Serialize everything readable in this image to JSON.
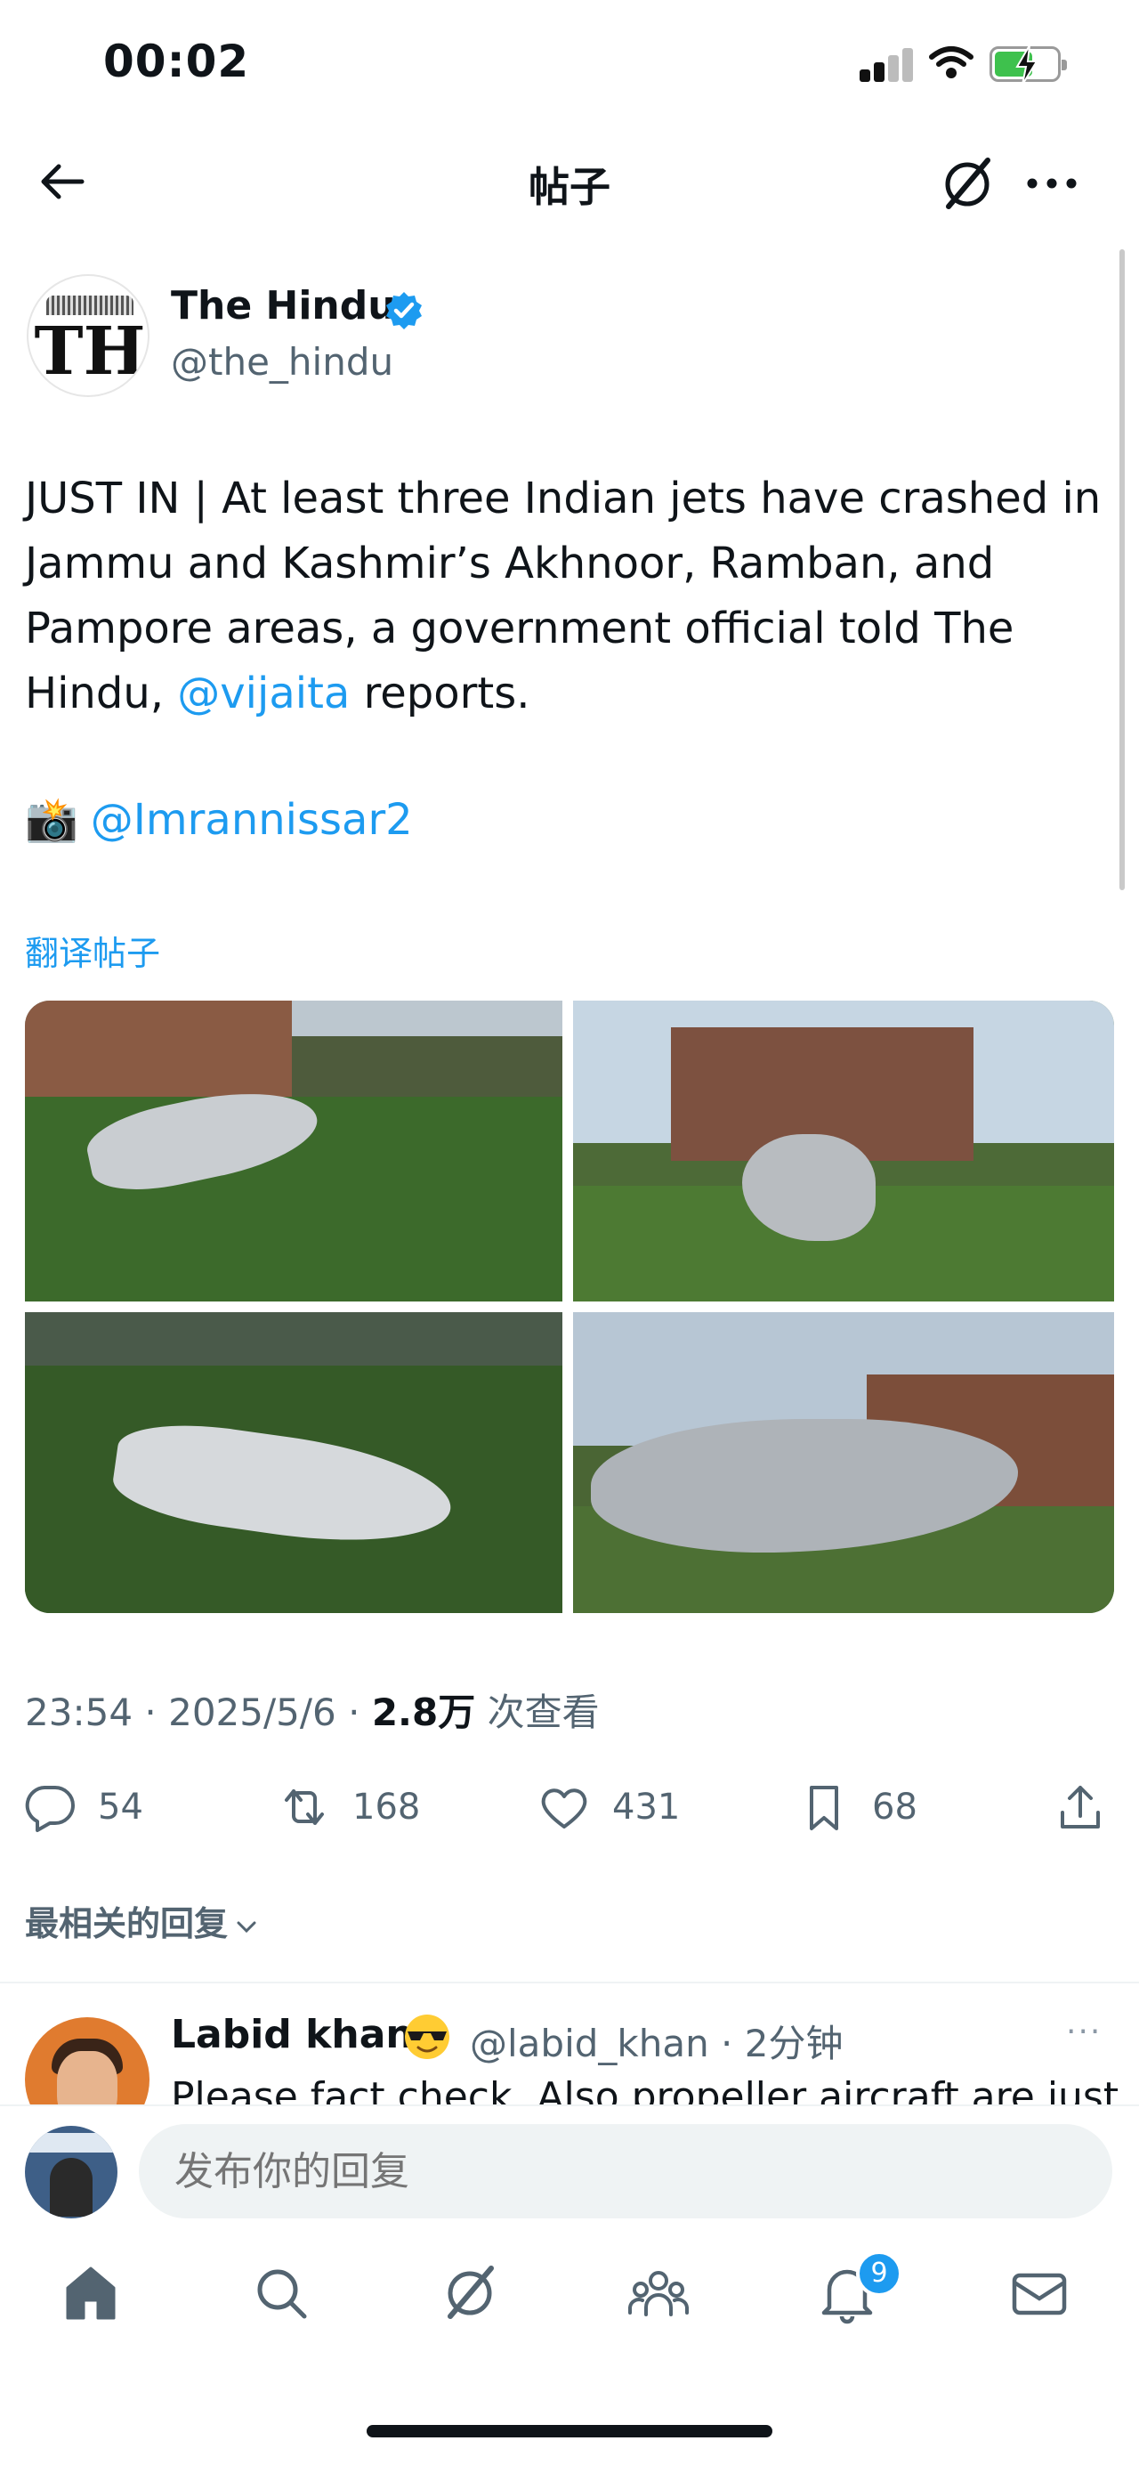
{
  "status_bar": {
    "time": "00:02"
  },
  "header": {
    "title": "帖子"
  },
  "post": {
    "author_name": "The Hindu",
    "author_handle": "@the_hindu",
    "avatar_text": "TH",
    "text_part1": "JUST IN | At least three Indian jets have crashed in Jammu and Kashmir’s Akhnoor, Ramban, and Pampore areas, a government official told The Hindu, ",
    "mention": "@vijaita",
    "text_part2": " reports.",
    "camera_emoji": "📸",
    "camera_mention": "@Imrannissar2",
    "translate_label": "翻译帖子",
    "time": "23:54",
    "date": "2025/5/6",
    "views": "2.8万",
    "views_label": "次查看",
    "stats": {
      "replies": "54",
      "reposts": "168",
      "likes": "431",
      "bookmarks": "68"
    }
  },
  "replies_sort_label": "最相关的回复",
  "reply": {
    "name": "Labid khan",
    "handle_time": "@labid_khan · 2分钟",
    "text": "Please fact check. Also propeller aircraft are just",
    "more": "···"
  },
  "composer": {
    "placeholder": "发布你的回复"
  },
  "tabbar": {
    "notification_count": "9"
  },
  "colors": {
    "accent": "#1d9bf0",
    "text": "#0f1419",
    "secondary": "#536471"
  }
}
